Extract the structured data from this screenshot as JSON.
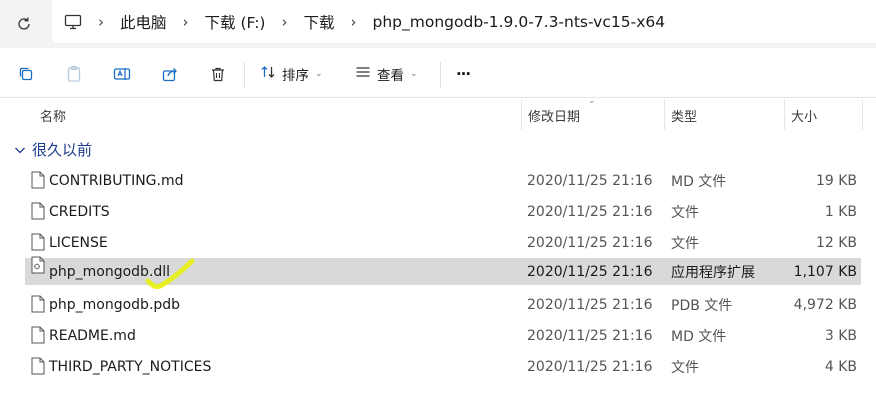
{
  "address_bar": {
    "breadcrumbs": [
      "此电脑",
      "下载 (F:)",
      "下载",
      "php_mongodb-1.9.0-7.3-nts-vc15-x64"
    ]
  },
  "toolbar": {
    "sort_label": "排序",
    "view_label": "查看",
    "more_label": "···"
  },
  "columns": {
    "name": "名称",
    "modified": "修改日期",
    "type": "类型",
    "size": "大小"
  },
  "group": {
    "label": "很久以前"
  },
  "files": [
    {
      "name": "CONTRIBUTING.md",
      "modified": "2020/11/25 21:16",
      "type": "MD 文件",
      "size": "19 KB"
    },
    {
      "name": "CREDITS",
      "modified": "2020/11/25 21:16",
      "type": "文件",
      "size": "1 KB"
    },
    {
      "name": "LICENSE",
      "modified": "2020/11/25 21:16",
      "type": "文件",
      "size": "12 KB"
    },
    {
      "name": "php_mongodb.dll",
      "modified": "2020/11/25 21:16",
      "type": "应用程序扩展",
      "size": "1,107 KB"
    },
    {
      "name": "php_mongodb.pdb",
      "modified": "2020/11/25 21:16",
      "type": "PDB 文件",
      "size": "4,972 KB"
    },
    {
      "name": "README.md",
      "modified": "2020/11/25 21:16",
      "type": "MD 文件",
      "size": "3 KB"
    },
    {
      "name": "THIRD_PARTY_NOTICES",
      "modified": "2020/11/25 21:16",
      "type": "文件",
      "size": "4 KB"
    }
  ],
  "selected_file": "php_mongodb.dll",
  "colors": {
    "group_header": "#1c3c8c",
    "selection": "#d9d9d9",
    "accent_icon": "#1a6fc4",
    "scribble": "#e8f000"
  }
}
